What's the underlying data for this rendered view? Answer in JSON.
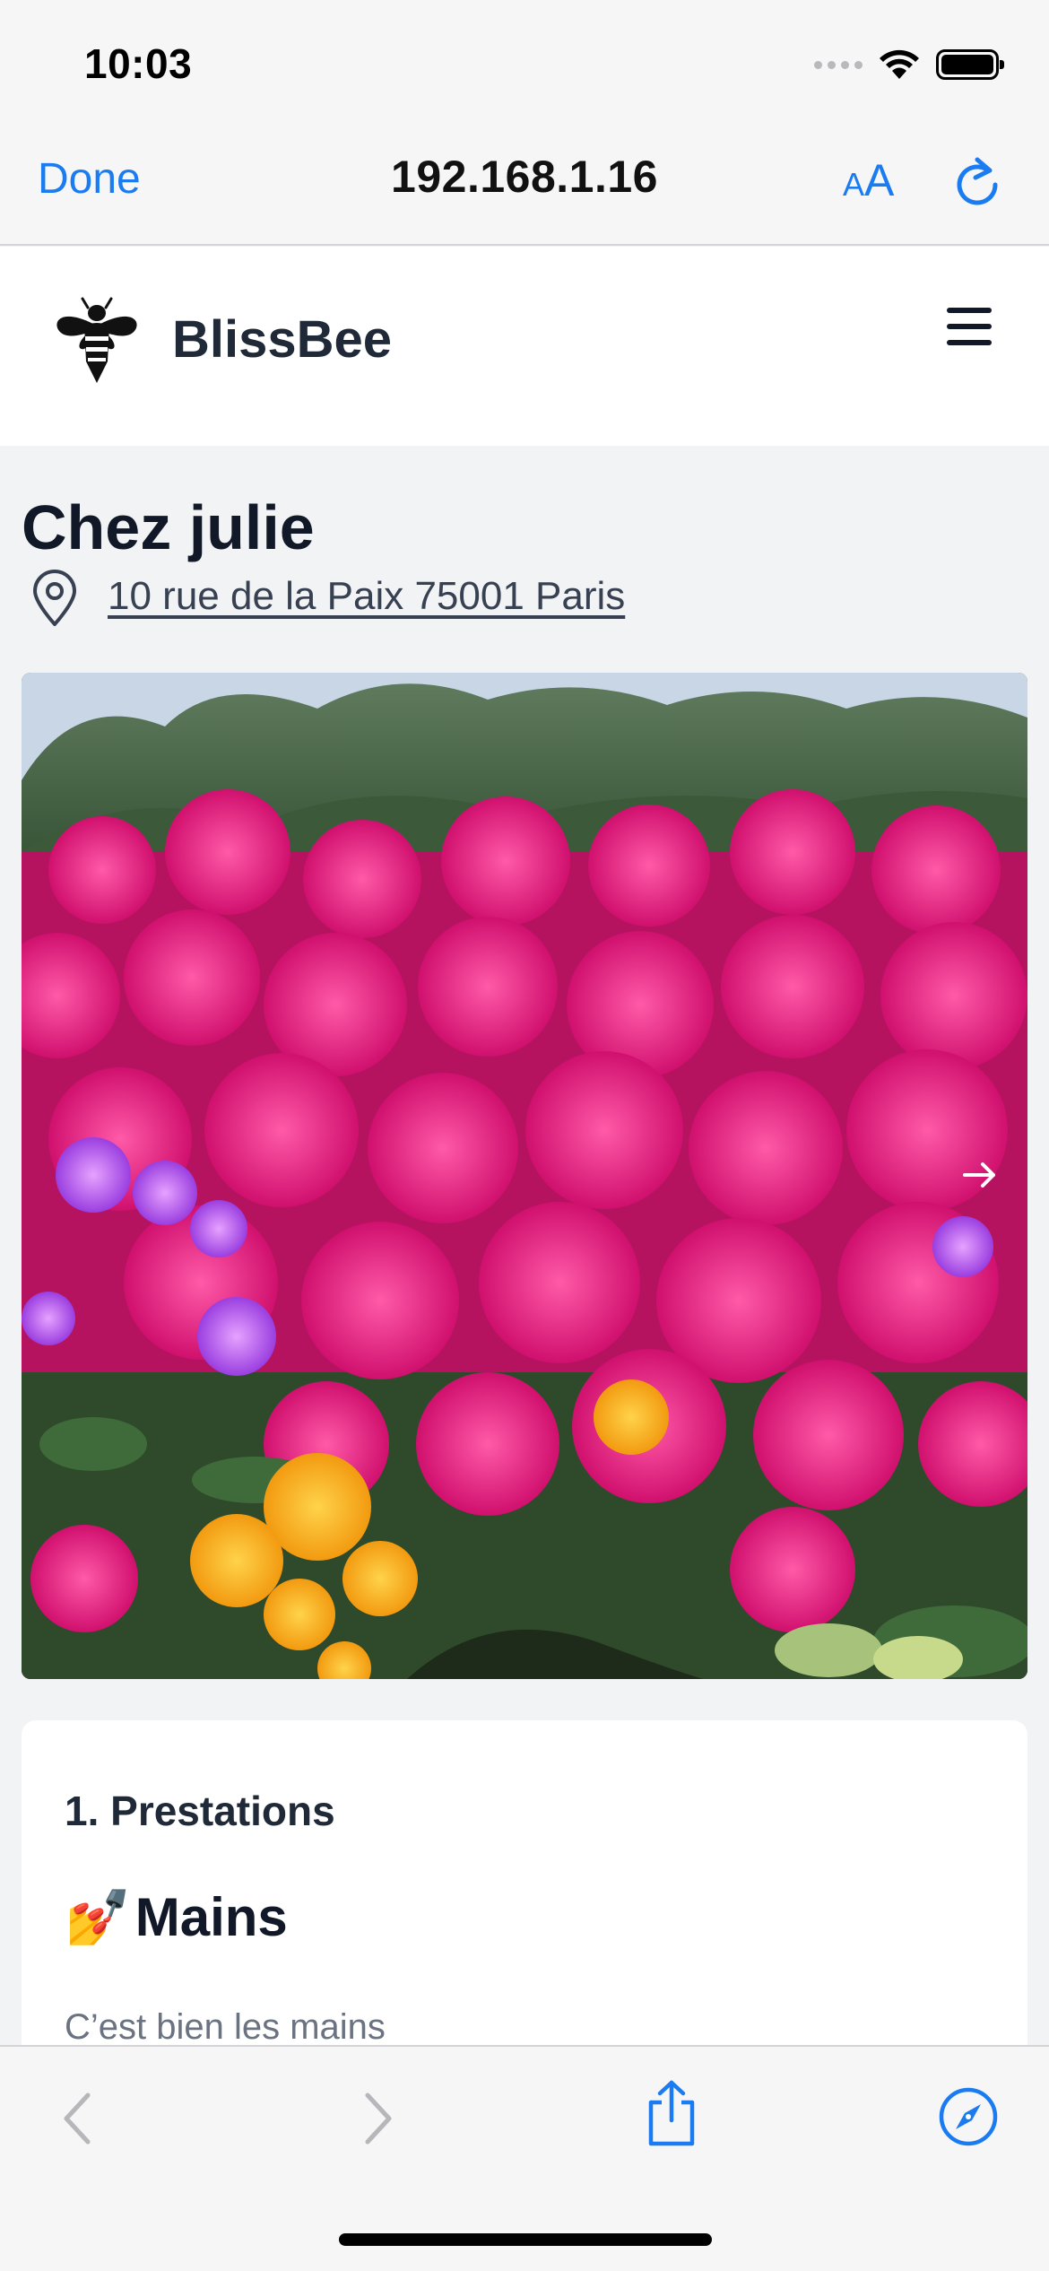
{
  "status_bar": {
    "time": "10:03"
  },
  "browser": {
    "done_label": "Done",
    "url": "192.168.1.16",
    "text_size_small": "A",
    "text_size_large": "A"
  },
  "site": {
    "brand": "BlissBee"
  },
  "salon": {
    "name": "Chez julie",
    "address": "10 rue de la Paix 75001 Paris"
  },
  "services": {
    "heading": "1. Prestations",
    "category_emoji": "💅",
    "category_title": "Mains",
    "category_description": "C’est bien les mains"
  },
  "colors": {
    "ios_blue": "#1a7cf0",
    "disabled_gray": "#b7b7bb",
    "text_dark": "#111827"
  },
  "icons": {
    "brand": "bee-icon",
    "menu": "hamburger-icon",
    "address": "map-pin-icon",
    "carousel_next": "arrow-right-icon",
    "back": "chevron-left-icon",
    "forward": "chevron-right-icon",
    "share": "share-icon",
    "safari": "compass-icon"
  }
}
